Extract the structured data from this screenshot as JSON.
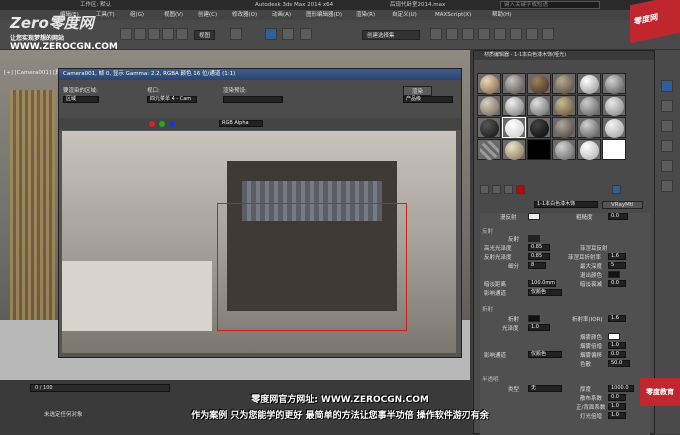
{
  "titlebar": {
    "workspace": "工作区: 默认",
    "app_title": "Autodesk 3ds Max 2014 x64",
    "file_title": "后现代卧室2014.max",
    "search_placeholder": "键入关键字或短语"
  },
  "menu": [
    "编辑(E)",
    "工具(T)",
    "组(G)",
    "视图(V)",
    "创建(C)",
    "修改器(O)",
    "动画(A)",
    "图形编辑器(D)",
    "渲染(R)",
    "自定义(U)",
    "MAXScript(X)",
    "帮助(H)"
  ],
  "toolbar": {
    "selection_filter": "全部",
    "view_label": "视图",
    "selection_set": "创建选择集"
  },
  "brand": {
    "name": "Zero零度网",
    "slogan": "让您实现梦想的网站",
    "url": "WWW.ZEROCGN.COM",
    "badge": "零度网",
    "edu": "零度教育"
  },
  "viewport": {
    "label": "[+] [Camera001] [真实]",
    "frame": "0 / 100",
    "status": "未选定任何对象"
  },
  "vfb": {
    "title": "Camera001, 帧 0, 显示 Gamma: 2.2, RGBA 颜色 16 位/通道 (1:1)",
    "area_label": "要渲染的区域:",
    "area_value": "区域",
    "viewport_label": "视口:",
    "viewport_value": "四元菜单 4 - Cam",
    "preset_label": "渲染预设:",
    "render_btn": "渲染",
    "product_value": "产品级",
    "channel": "RGB Alpha"
  },
  "matwin": {
    "title": "材质编辑器 - 1-1本白色漆木饰(哑光)",
    "material_name": "1-1本白色漆木饰",
    "material_type": "VRayMtl",
    "params": {
      "roughness_label": "粗糙度",
      "roughness": "0.0",
      "diffuse_label": "漫反射",
      "reflect_section": "反射",
      "reflect_label": "反射",
      "hilight_gloss_label": "高光光泽度",
      "hilight_gloss": "0.85",
      "refl_gloss_label": "反射光泽度",
      "refl_gloss": "0.85",
      "subdivs_label": "细分",
      "subdivs": "8",
      "fresnel_label": "菲涅耳反射",
      "fresnel_ior_label": "菲涅耳折射率",
      "fresnel_ior": "1.6",
      "max_depth_label": "最大深度",
      "max_depth": "5",
      "exit_color_label": "退出颜色",
      "dim_dist_label": "暗淡距离",
      "dim_dist": "100.0mm",
      "dim_falloff_label": "暗淡衰减",
      "dim_falloff": "0.0",
      "affect_channels_label": "影响通道",
      "affect_channels": "仅颜色",
      "refract_section": "折射",
      "refract_label": "折射",
      "ior_label": "折射率(IOR)",
      "ior": "1.6",
      "gloss_label": "光泽度",
      "gloss": "1.0",
      "fog_color_label": "烟雾颜色",
      "fog_mult_label": "烟雾倍增",
      "fog_mult": "1.0",
      "fog_bias_label": "烟雾偏移",
      "fog_bias": "0.0",
      "translucency_section": "半透明",
      "translucency_type_label": "类型",
      "translucency_type": "无",
      "thickness_label": "厚度",
      "thickness": "1000.0",
      "scatter_coeff_label": "散布系数",
      "scatter_coeff": "0.0",
      "fwd_bck_label": "正/背面系数",
      "fwd_bck": "1.0",
      "light_mult_label": "灯光倍增",
      "light_mult": "1.0",
      "abbe_label": "色散",
      "abbe": "50.0"
    }
  },
  "subtitles": {
    "line1": "零度网官方网址: WWW.ZEROCGN.COM",
    "line2": "作为案例 只为您能学的更好 最简单的方法让您事半功倍 操作软件游刃有余"
  }
}
